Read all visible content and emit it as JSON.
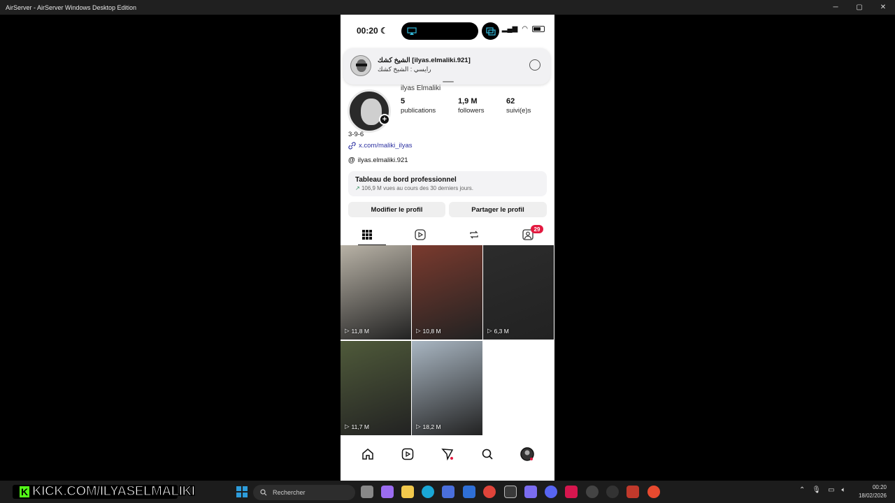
{
  "window": {
    "title": "AirServer - AirServer Windows Desktop Edition"
  },
  "status_bar": {
    "time": "00:20"
  },
  "notification": {
    "title": "الشيخ كشك [ilyas.elmaliki.921]",
    "body": "رايسي : الشيخ كشك"
  },
  "profile": {
    "username": "ilyas Elmaliki",
    "posts_count": "5",
    "posts_label": "publications",
    "followers_count": "1,9 M",
    "followers_label": "followers",
    "following_count": "62",
    "following_label": "suivi(e)s",
    "bio": "3-9-6",
    "link": "x.com/maliki_ilyas",
    "threads": "ilyas.elmaliki.921"
  },
  "dashboard": {
    "title": "Tableau de bord professionnel",
    "subtitle": "106,9 M vues au cours des 30 derniers jours."
  },
  "buttons": {
    "edit": "Modifier le profil",
    "share": "Partager le profil"
  },
  "tabs": {
    "tagged_badge": "29"
  },
  "posts": [
    {
      "views": "11,8 M",
      "color": "#b8b2a6"
    },
    {
      "views": "10,8 M",
      "color": "#7a3a2e"
    },
    {
      "views": "6,3 M",
      "color": "#2c2c2c"
    },
    {
      "views": "11,7 M",
      "color": "#4f5a3a"
    },
    {
      "views": "18,2 M",
      "color": "#a9b6c2"
    }
  ],
  "taskbar": {
    "kick_text": "KICK.COM/ILYASELMALIKI",
    "search_label": "Rechercher",
    "clock_time": "00:20",
    "clock_date": "18/02/2026"
  },
  "colors": {
    "badge": "#e3193f",
    "link": "#2a2fa0"
  }
}
